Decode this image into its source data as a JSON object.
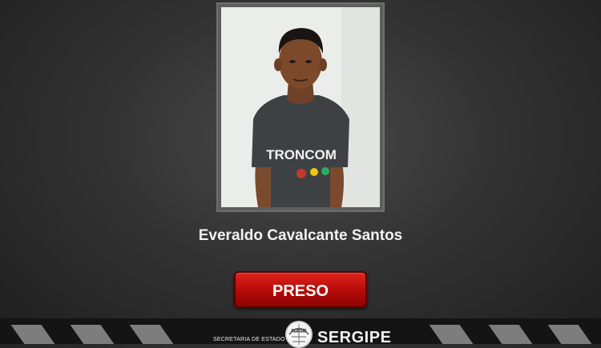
{
  "card": {
    "name": "Everaldo Cavalcante Santos",
    "status_label": "PRESO",
    "photo_shirt_text": "TRONCOM"
  },
  "footer": {
    "secretaria_text": "SECRETARIA DE ESTADO",
    "state_name": "SERGIPE",
    "seal_text": "PORVIR"
  },
  "colors": {
    "status_red": "#c8140e",
    "background_dark": "#333333"
  }
}
